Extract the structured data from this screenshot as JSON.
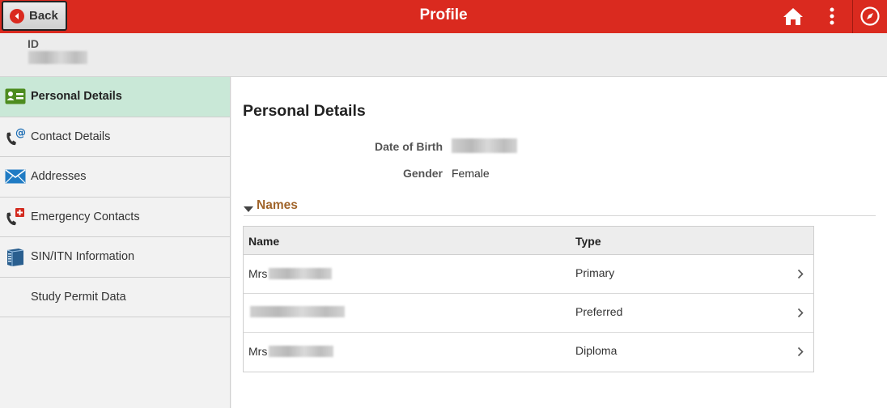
{
  "header": {
    "back_label": "Back",
    "title": "Profile",
    "icons": [
      "arrow-left-icon",
      "home-icon",
      "more-vertical-icon",
      "navbar-compass-icon"
    ],
    "color": "#da2a1f"
  },
  "idbar": {
    "label": "ID"
  },
  "sidebar": {
    "items": [
      {
        "label": "Personal Details",
        "icon": "id-card-icon",
        "active": true
      },
      {
        "label": "Contact Details",
        "icon": "phone-email-icon",
        "active": false
      },
      {
        "label": "Addresses",
        "icon": "envelope-icon",
        "active": false
      },
      {
        "label": "Emergency Contacts",
        "icon": "phone-medical-icon",
        "active": false
      },
      {
        "label": "SIN/ITN Information",
        "icon": "server-icon",
        "active": false
      },
      {
        "label": "Study Permit Data",
        "icon": "",
        "active": false
      }
    ],
    "active_color": "#c9e8d7"
  },
  "main": {
    "title": "Personal Details",
    "dob_label": "Date of Birth",
    "gender_label": "Gender",
    "gender_value": "Female",
    "names_section": "Names",
    "grid": {
      "col_name": "Name",
      "col_type": "Type",
      "rows": [
        {
          "prefix": "Mrs",
          "type": "Primary"
        },
        {
          "prefix": "",
          "type": "Preferred"
        },
        {
          "prefix": "Mrs",
          "type": "Diploma"
        }
      ]
    }
  }
}
